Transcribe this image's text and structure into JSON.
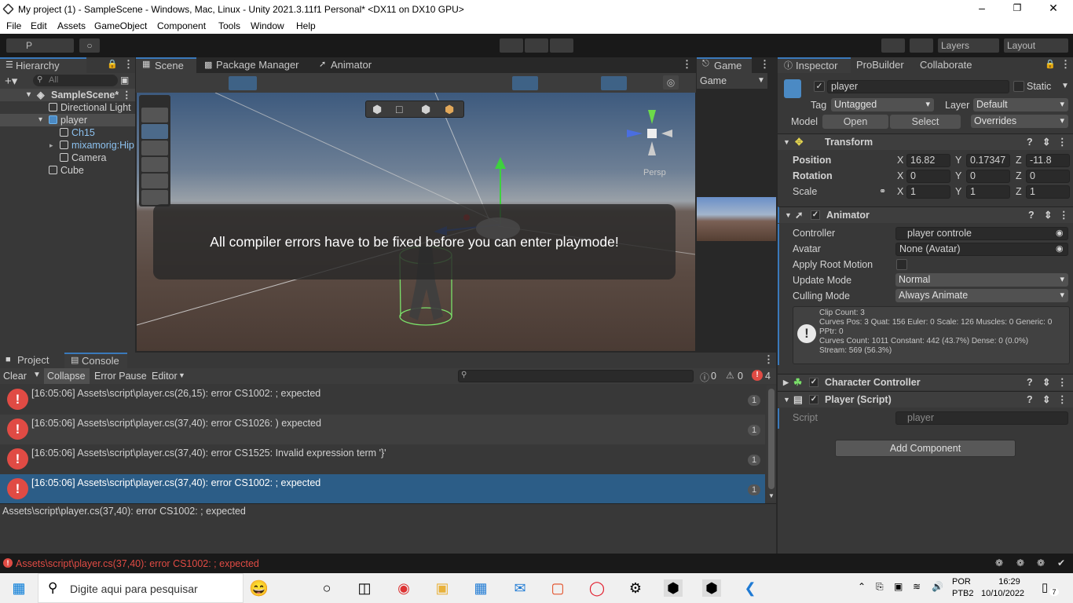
{
  "window": {
    "title": "My project (1) - SampleScene - Windows, Mac, Linux - Unity 2021.3.11f1 Personal* <DX11 on DX10 GPU>"
  },
  "menu": [
    "File",
    "Edit",
    "Assets",
    "GameObject",
    "Component",
    "Tools",
    "Window",
    "Help"
  ],
  "toolbar": {
    "p_label": "P",
    "layers": "Layers",
    "layout": "Layout"
  },
  "hierarchy": {
    "tab": "Hierarchy",
    "search_placeholder": "All",
    "items": [
      {
        "label": "SampleScene*"
      },
      {
        "label": "Directional Light"
      },
      {
        "label": "player"
      },
      {
        "label": "Ch15"
      },
      {
        "label": "mixamorig:Hip"
      },
      {
        "label": "Camera"
      },
      {
        "label": "Cube"
      }
    ]
  },
  "scene_tabs": {
    "scene": "Scene",
    "package_manager": "Package Manager",
    "animator": "Animator"
  },
  "scene": {
    "persp": "Persp",
    "overlay_message": "All compiler errors have to be fixed before you can enter playmode!"
  },
  "game": {
    "tab": "Game",
    "display": "Game"
  },
  "inspector": {
    "tabs": {
      "inspector": "Inspector",
      "probuilder": "ProBuilder",
      "collaborate": "Collaborate"
    },
    "object_name": "player",
    "static_label": "Static",
    "tag_label": "Tag",
    "tag_value": "Untagged",
    "layer_label": "Layer",
    "layer_value": "Default",
    "model_label": "Model",
    "open": "Open",
    "select": "Select",
    "overrides": "Overrides",
    "transform": {
      "header": "Transform",
      "position_label": "Position",
      "rotation_label": "Rotation",
      "scale_label": "Scale",
      "x": "X",
      "y": "Y",
      "z": "Z",
      "position": {
        "x": "16.82",
        "y": "0.17347",
        "z": "-11.8"
      },
      "rotation": {
        "x": "0",
        "y": "0",
        "z": "0"
      },
      "scale": {
        "x": "1",
        "y": "1",
        "z": "1"
      }
    },
    "animator": {
      "header": "Animator",
      "controller_label": "Controller",
      "controller_value": "player controle",
      "avatar_label": "Avatar",
      "avatar_value": "None (Avatar)",
      "apply_root_motion_label": "Apply Root Motion",
      "update_mode_label": "Update Mode",
      "update_mode_value": "Normal",
      "culling_mode_label": "Culling Mode",
      "culling_mode_value": "Always Animate",
      "info": [
        "Clip Count: 3",
        "Curves Pos: 3 Quat: 156 Euler: 0 Scale: 126 Muscles: 0 Generic: 0",
        "PPtr: 0",
        "Curves Count: 1011 Constant: 442 (43.7%) Dense: 0 (0.0%)",
        "Stream: 569 (56.3%)"
      ]
    },
    "character_controller": {
      "header": "Character Controller"
    },
    "player_script": {
      "header": "Player (Script)",
      "script_label": "Script",
      "script_value": "player"
    },
    "add_component": "Add Component"
  },
  "console": {
    "tabs": {
      "project": "Project",
      "console": "Console"
    },
    "clear": "Clear",
    "collapse": "Collapse",
    "error_pause": "Error Pause",
    "editor": "Editor",
    "counts": {
      "log": "0",
      "warn": "0",
      "error": "4"
    },
    "rows": [
      {
        "text": "[16:05:06] Assets\\script\\player.cs(26,15): error CS1002: ; expected",
        "count": "1"
      },
      {
        "text": "[16:05:06] Assets\\script\\player.cs(37,40): error CS1026: ) expected",
        "count": "1"
      },
      {
        "text": "[16:05:06] Assets\\script\\player.cs(37,40): error CS1525: Invalid expression term '}'",
        "count": "1"
      },
      {
        "text": "[16:05:06] Assets\\script\\player.cs(37,40): error CS1002: ; expected",
        "count": "1"
      }
    ],
    "detail": "Assets\\script\\player.cs(37,40): error CS1002: ; expected"
  },
  "status_bar": {
    "message": "Assets\\script\\player.cs(37,40): error CS1002: ; expected"
  },
  "taskbar": {
    "search_placeholder": "Digite aqui para pesquisar",
    "lang": "POR",
    "lang2": "PTB2",
    "time": "16:29",
    "date": "10/10/2022",
    "notif_count": "7"
  },
  "colors": {
    "accent": "#3a79bb",
    "error": "#e04b44",
    "selected_row": "#2c5d87"
  }
}
